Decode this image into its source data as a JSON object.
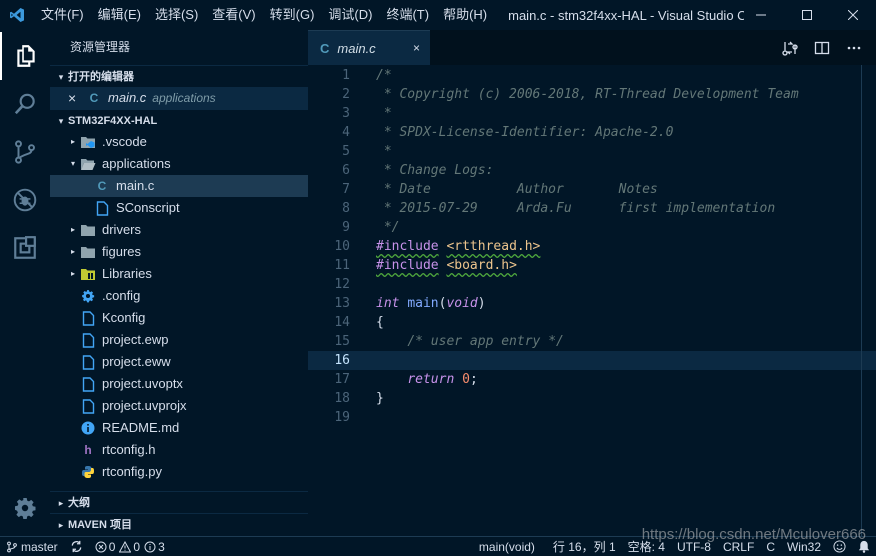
{
  "titlebar": {
    "menus": [
      "文件(F)",
      "编辑(E)",
      "选择(S)",
      "查看(V)",
      "转到(G)",
      "调试(D)",
      "终端(T)",
      "帮助(H)"
    ],
    "window_title": "main.c - stm32f4xx-HAL - Visual Studio C..."
  },
  "activitybar": {
    "icons": [
      "explorer-icon",
      "search-icon",
      "source-control-icon",
      "debug-icon",
      "extensions-icon",
      "settings-gear-icon"
    ]
  },
  "sidebar": {
    "title": "资源管理器",
    "open_editors_header": "打开的编辑器",
    "open_editor": {
      "close": "×",
      "name": "main.c",
      "desc": "applications"
    },
    "project_header": "STM32F4XX-HAL",
    "tree": [
      {
        "name": ".vscode",
        "type": "folder-vscode",
        "twist": "▸",
        "indent": 1
      },
      {
        "name": "applications",
        "type": "folder-open",
        "twist": "▾",
        "indent": 1
      },
      {
        "name": "main.c",
        "type": "c",
        "twist": "",
        "indent": 2
      },
      {
        "name": "SConscript",
        "type": "file-outline",
        "twist": "",
        "indent": 2
      },
      {
        "name": "drivers",
        "type": "folder",
        "twist": "▸",
        "indent": 1
      },
      {
        "name": "figures",
        "type": "folder",
        "twist": "▸",
        "indent": 1
      },
      {
        "name": "Libraries",
        "type": "folder-lib",
        "twist": "▸",
        "indent": 1
      },
      {
        "name": ".config",
        "type": "gear",
        "twist": "",
        "indent": 1
      },
      {
        "name": "Kconfig",
        "type": "file-outline",
        "twist": "",
        "indent": 1
      },
      {
        "name": "project.ewp",
        "type": "file-outline",
        "twist": "",
        "indent": 1
      },
      {
        "name": "project.eww",
        "type": "file-outline",
        "twist": "",
        "indent": 1
      },
      {
        "name": "project.uvoptx",
        "type": "file-outline",
        "twist": "",
        "indent": 1
      },
      {
        "name": "project.uvprojx",
        "type": "file-outline",
        "twist": "",
        "indent": 1
      },
      {
        "name": "README.md",
        "type": "info",
        "twist": "",
        "indent": 1
      },
      {
        "name": "rtconfig.h",
        "type": "h",
        "twist": "",
        "indent": 1
      },
      {
        "name": "rtconfig.py",
        "type": "python",
        "twist": "",
        "indent": 1
      }
    ],
    "outline_header": "大纲",
    "maven_header": "MAVEN 项目"
  },
  "editor": {
    "tab_label": "main.c",
    "tab_close": "×",
    "current_line": 16,
    "lines": [
      {
        "n": "1",
        "parts": [
          [
            "cm",
            "/*"
          ]
        ]
      },
      {
        "n": "2",
        "parts": [
          [
            "cm",
            " * Copyright (c) 2006-2018, RT-Thread Development Team"
          ]
        ]
      },
      {
        "n": "3",
        "parts": [
          [
            "cm",
            " *"
          ]
        ]
      },
      {
        "n": "4",
        "parts": [
          [
            "cm",
            " * SPDX-License-Identifier: Apache-2.0"
          ]
        ]
      },
      {
        "n": "5",
        "parts": [
          [
            "cm",
            " *"
          ]
        ]
      },
      {
        "n": "6",
        "parts": [
          [
            "cm",
            " * Change Logs:"
          ]
        ]
      },
      {
        "n": "7",
        "parts": [
          [
            "cm",
            " * Date           Author       Notes"
          ]
        ]
      },
      {
        "n": "8",
        "parts": [
          [
            "cm",
            " * 2015-07-29     Arda.Fu      first implementation"
          ]
        ]
      },
      {
        "n": "9",
        "parts": [
          [
            "cm",
            " */"
          ]
        ]
      },
      {
        "n": "10",
        "parts": [
          [
            "pre squig",
            "#include"
          ],
          [
            "",
            " "
          ],
          [
            "str squig",
            "<rtthread.h>"
          ]
        ]
      },
      {
        "n": "11",
        "parts": [
          [
            "pre squig",
            "#include"
          ],
          [
            "",
            " "
          ],
          [
            "str squig",
            "<board.h>"
          ]
        ]
      },
      {
        "n": "12",
        "parts": []
      },
      {
        "n": "13",
        "parts": [
          [
            "kw",
            "int"
          ],
          [
            "",
            " "
          ],
          [
            "fn",
            "main"
          ],
          [
            "",
            "("
          ],
          [
            "kw",
            "void"
          ],
          [
            "",
            ")"
          ]
        ]
      },
      {
        "n": "14",
        "parts": [
          [
            "",
            "{"
          ]
        ]
      },
      {
        "n": "15",
        "parts": [
          [
            "",
            "    "
          ],
          [
            "cm",
            "/* user app entry */"
          ]
        ]
      },
      {
        "n": "16",
        "parts": []
      },
      {
        "n": "17",
        "parts": [
          [
            "",
            "    "
          ],
          [
            "kw",
            "return"
          ],
          [
            "",
            " "
          ],
          [
            "num",
            "0"
          ],
          [
            "",
            ";"
          ]
        ]
      },
      {
        "n": "18",
        "parts": [
          [
            "",
            "}"
          ]
        ]
      },
      {
        "n": "19",
        "parts": []
      }
    ]
  },
  "statusbar": {
    "branch": "master",
    "errors": "0",
    "warnings": "0",
    "infos": "3",
    "scope": "main(void)",
    "position": "行 16，列 1",
    "indent": "空格: 4",
    "encoding": "UTF-8",
    "eol": "CRLF",
    "language": "C",
    "platform": "Win32"
  },
  "watermark": "https://blog.csdn.net/Mculover666"
}
